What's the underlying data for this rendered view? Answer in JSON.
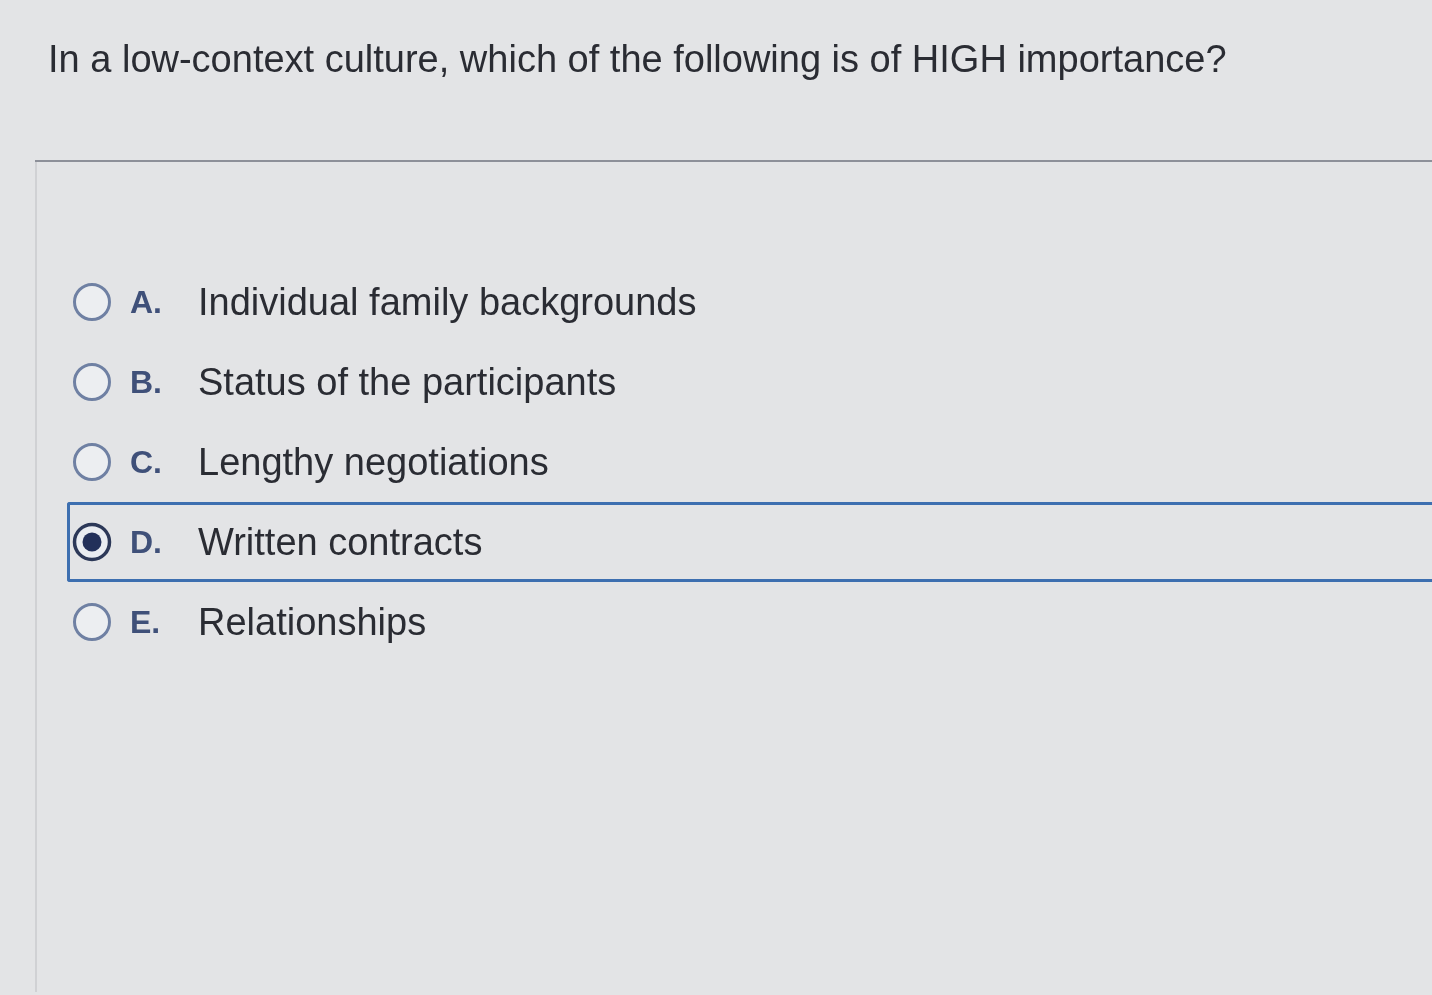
{
  "question": {
    "text": "In a low-context culture, which of the following is of HIGH importance?"
  },
  "options": [
    {
      "letter": "A.",
      "text": "Individual family backgrounds",
      "selected": false
    },
    {
      "letter": "B.",
      "text": "Status of the participants",
      "selected": false
    },
    {
      "letter": "C.",
      "text": "Lengthy negotiations",
      "selected": false
    },
    {
      "letter": "D.",
      "text": "Written contracts",
      "selected": true
    },
    {
      "letter": "E.",
      "text": "Relationships",
      "selected": false
    }
  ]
}
